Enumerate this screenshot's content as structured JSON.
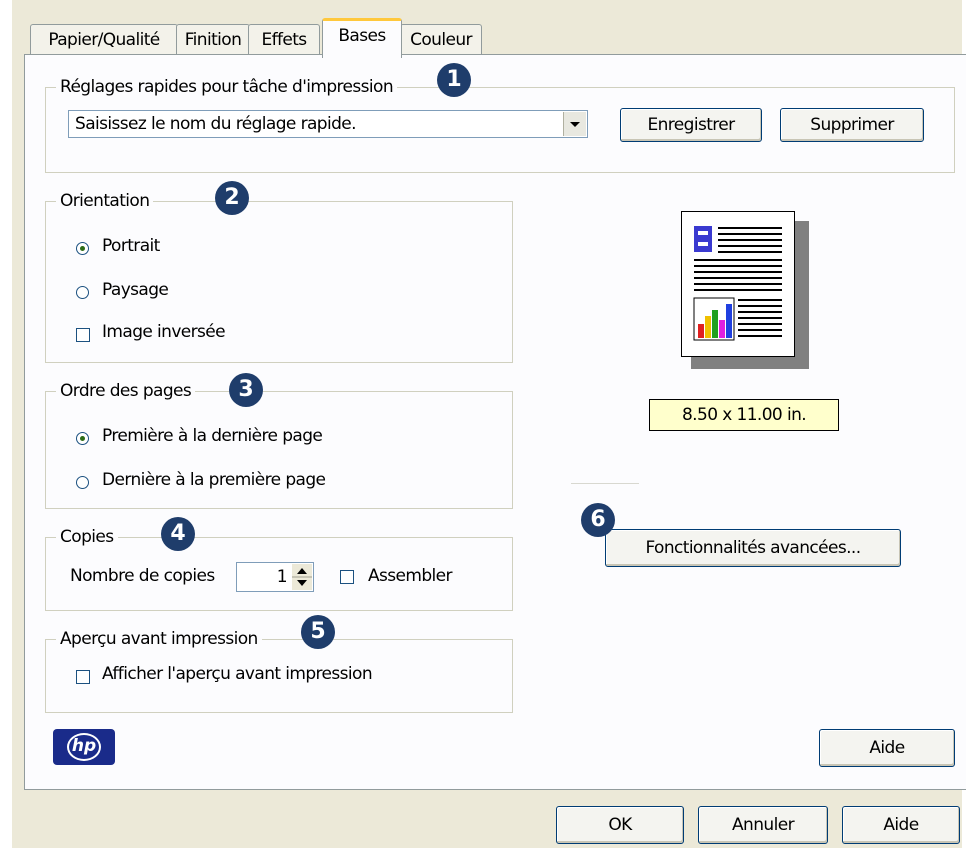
{
  "tabs": [
    "Papier/Qualité",
    "Finition",
    "Effets",
    "Bases",
    "Couleur"
  ],
  "badges": [
    "1",
    "2",
    "3",
    "4",
    "5",
    "6"
  ],
  "quick_settings": {
    "legend": "Réglages rapides pour tâche d'impression",
    "select_value": "Saisissez le nom du réglage rapide.",
    "save_label": "Enregistrer",
    "delete_label": "Supprimer"
  },
  "orientation": {
    "legend": "Orientation",
    "portrait": "Portrait",
    "landscape": "Paysage",
    "mirror": "Image inversée",
    "selected": "portrait"
  },
  "page_order": {
    "legend": "Ordre des pages",
    "first_to_last": "Première à la dernière page",
    "last_to_first": "Dernière à la première page",
    "selected": "first_to_last"
  },
  "copies": {
    "legend": "Copies",
    "count_label": "Nombre de copies",
    "count_value": "1",
    "collate_label": "Assembler"
  },
  "preview": {
    "legend": "Aperçu avant impression",
    "show_label": "Afficher l'aperçu avant impression"
  },
  "paper_size_label": "8.50 x 11.00 in.",
  "advanced_button": "Fonctionnalités avancées...",
  "logo_text": "hp",
  "panel_help": "Aide",
  "footer": {
    "ok": "OK",
    "cancel": "Annuler",
    "help": "Aide"
  },
  "colors": {
    "badge": "#1f3d6b",
    "size_label_bg": "#ffffcc",
    "tab_accent": "#ffc83c"
  }
}
